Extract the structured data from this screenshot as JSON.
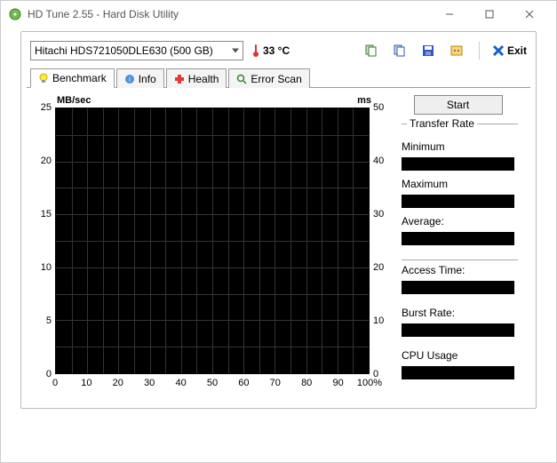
{
  "window": {
    "title": "HD Tune 2.55 - Hard Disk Utility"
  },
  "toolbar": {
    "drive": "Hitachi HDS721050DLE630 (500 GB)",
    "temperature": "33 °C",
    "exit_label": "Exit"
  },
  "tabs": {
    "benchmark": "Benchmark",
    "info": "Info",
    "health": "Health",
    "error_scan": "Error Scan"
  },
  "chart_data": {
    "type": "line",
    "y_left_label": "MB/sec",
    "y_right_label": "ms",
    "y_left_ticks": [
      "25",
      "20",
      "15",
      "10",
      "5",
      "0"
    ],
    "y_right_ticks": [
      "50",
      "40",
      "30",
      "20",
      "10",
      "0"
    ],
    "x_ticks": [
      "0",
      "10",
      "20",
      "30",
      "40",
      "50",
      "60",
      "70",
      "80",
      "90",
      "100%"
    ],
    "y_left_range": [
      0,
      25
    ],
    "y_right_range": [
      0,
      50
    ],
    "x_range_pct": [
      0,
      100
    ],
    "series": []
  },
  "side": {
    "start_label": "Start",
    "transfer_rate_label": "Transfer Rate",
    "min_label": "Minimum",
    "max_label": "Maximum",
    "avg_label": "Average:",
    "access_label": "Access Time:",
    "burst_label": "Burst Rate:",
    "cpu_label": "CPU Usage"
  }
}
